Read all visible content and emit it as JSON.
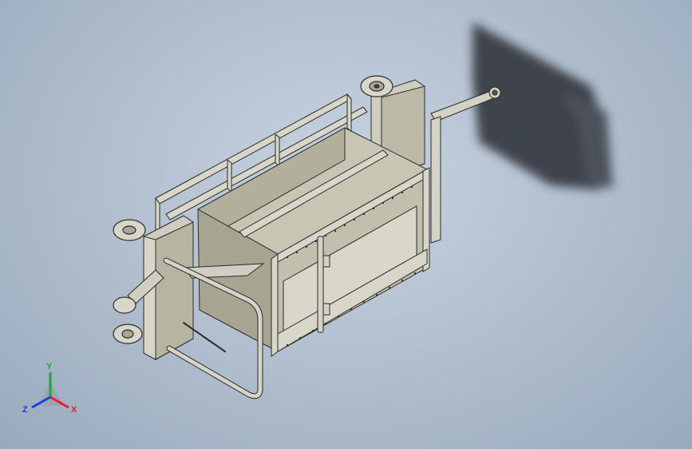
{
  "viewport": {
    "background_top": "#c9d3e0",
    "background_bottom": "#9aa9bd"
  },
  "model": {
    "frame_color": "#d4d2c4",
    "edge_color": "#2b2b2b",
    "panel_color": "#bcb9a8",
    "shadow_color": "#2a2e35"
  },
  "triad": {
    "x_label": "X",
    "y_label": "Y",
    "z_label": "Z",
    "x_color": "#e8202a",
    "y_color": "#1fa83a",
    "z_color": "#1f3fd6"
  }
}
